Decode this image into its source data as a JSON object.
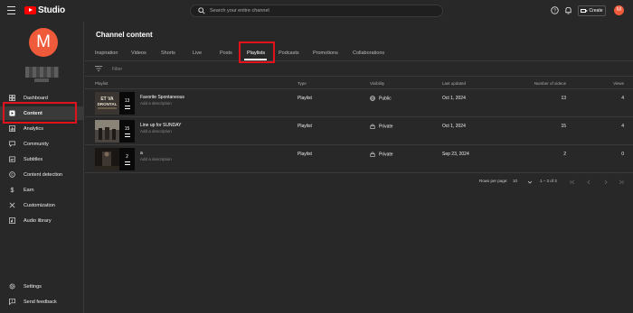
{
  "header": {
    "logo_text": "Studio",
    "search_placeholder": "Search your entire channel",
    "create_label": "Create",
    "avatar_letter": "M"
  },
  "sidebar": {
    "avatar_letter": "M",
    "items": [
      {
        "label": "Dashboard",
        "icon": "dashboard-icon"
      },
      {
        "label": "Content",
        "icon": "content-icon"
      },
      {
        "label": "Analytics",
        "icon": "analytics-icon"
      },
      {
        "label": "Community",
        "icon": "community-icon"
      },
      {
        "label": "Subtitles",
        "icon": "subtitles-icon"
      },
      {
        "label": "Content detection",
        "icon": "content-detection-icon"
      },
      {
        "label": "Earn",
        "icon": "earn-icon"
      },
      {
        "label": "Customization",
        "icon": "customization-icon"
      },
      {
        "label": "Audio library",
        "icon": "audio-library-icon"
      }
    ],
    "bottom_items": [
      {
        "label": "Settings",
        "icon": "gear-icon"
      },
      {
        "label": "Send feedback",
        "icon": "feedback-icon"
      }
    ]
  },
  "main": {
    "title": "Channel content",
    "tabs": [
      "Inspiration",
      "Videos",
      "Shorts",
      "Live",
      "Posts",
      "Playlists",
      "Podcasts",
      "Promotions",
      "Collaborations"
    ],
    "active_tab": "Playlists",
    "filter_placeholder": "Filter",
    "columns": [
      "Playlist",
      "Type",
      "Visibility",
      "Last updated",
      "Number of videos",
      "Views"
    ],
    "rows": [
      {
        "title": "Favorite Spontaneous",
        "description": "Add a description",
        "type": "Playlist",
        "visibility": "Public",
        "last_updated": "Oct 1, 2024",
        "videos": "13",
        "views": "4",
        "thumb_count": "13"
      },
      {
        "title": "Line up for SUNDAY",
        "description": "Add a description",
        "type": "Playlist",
        "visibility": "Private",
        "last_updated": "Oct 1, 2024",
        "videos": "15",
        "views": "4",
        "thumb_count": "15"
      },
      {
        "title": "a",
        "description": "Add a description",
        "type": "Playlist",
        "visibility": "Private",
        "last_updated": "Sep 23, 2024",
        "videos": "2",
        "views": "0",
        "thumb_count": "2"
      }
    ],
    "pagination": {
      "rows_per_page_label": "Rows per page:",
      "rows_per_page_value": "10",
      "range_text": "1 – 3 of 3"
    }
  },
  "colors": {
    "background": "#282828",
    "accent_red": "#e2121c",
    "avatar": "#ef5a3a"
  }
}
